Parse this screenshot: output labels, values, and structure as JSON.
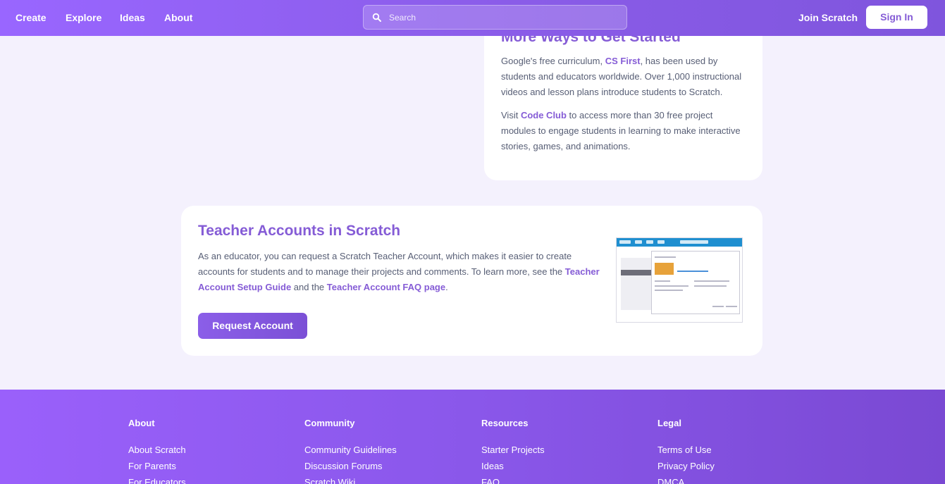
{
  "nav": {
    "create": "Create",
    "explore": "Explore",
    "ideas": "Ideas",
    "about": "About",
    "search_placeholder": "Search",
    "join": "Join Scratch",
    "signin": "Sign In"
  },
  "more_ways": {
    "title": "More Ways to Get Started",
    "p1_before": "Google's free curriculum, ",
    "p1_link": "CS First",
    "p1_after": ", has been used by students and educators worldwide. Over 1,000 instructional videos and lesson plans introduce students to Scratch.",
    "p2_before": "Visit ",
    "p2_link": "Code Club",
    "p2_after": " to access more than 30 free project modules to engage students in learning to make interactive stories, games, and animations."
  },
  "teacher": {
    "title": "Teacher Accounts in Scratch",
    "text_before": "As an educator, you can request a Scratch Teacher Account, which makes it easier to create accounts for students and to manage their projects and comments. To learn more, see the ",
    "link1": "Teacher Account Setup Guide",
    "text_mid": " and the ",
    "link2": "Teacher Account FAQ page",
    "text_after": ".",
    "button": "Request Account"
  },
  "footer": {
    "about": {
      "heading": "About",
      "links": [
        "About Scratch",
        "For Parents",
        "For Educators"
      ]
    },
    "community": {
      "heading": "Community",
      "links": [
        "Community Guidelines",
        "Discussion Forums",
        "Scratch Wiki"
      ]
    },
    "resources": {
      "heading": "Resources",
      "links": [
        "Starter Projects",
        "Ideas",
        "FAQ"
      ]
    },
    "legal": {
      "heading": "Legal",
      "links": [
        "Terms of Use",
        "Privacy Policy",
        "DMCA"
      ]
    }
  },
  "colors": {
    "brand_purple": "#855cd6",
    "nav_gradient_start": "#9966ff",
    "background": "#f4f1fd",
    "text": "#575e75"
  }
}
